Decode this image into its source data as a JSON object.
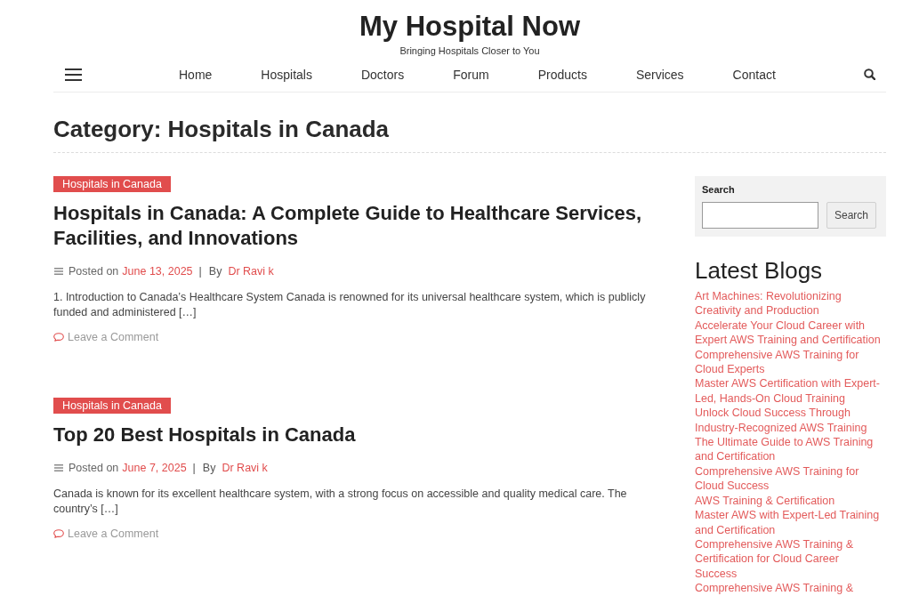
{
  "site": {
    "title": "My Hospital Now",
    "tagline": "Bringing Hospitals Closer to You"
  },
  "nav": [
    "Home",
    "Hospitals",
    "Doctors",
    "Forum",
    "Products",
    "Services",
    "Contact"
  ],
  "page_title": "Category: Hospitals in Canada",
  "posts": [
    {
      "category": "Hospitals in Canada",
      "title": "Hospitals in Canada: A Complete Guide to Healthcare Services, Facilities, and Innovations",
      "posted_label": "Posted on",
      "date": "June 13, 2025",
      "separator": "|",
      "by_label": "By",
      "author": "Dr Ravi k",
      "excerpt": "1. Introduction to Canada’s Healthcare System Canada is renowned for its universal healthcare system, which is publicly funded and administered […]",
      "comment_link": "Leave a Comment"
    },
    {
      "category": "Hospitals in Canada",
      "title": "Top 20 Best Hospitals in Canada",
      "posted_label": "Posted on",
      "date": "June 7, 2025",
      "separator": "|",
      "by_label": "By",
      "author": "Dr Ravi k",
      "excerpt": "Canada is known for its excellent healthcare system, with a strong focus on accessible and quality medical care. The country’s […]",
      "comment_link": "Leave a Comment"
    }
  ],
  "sidebar": {
    "search": {
      "label": "Search",
      "button": "Search"
    },
    "latest_blogs": {
      "title": "Latest Blogs",
      "items": [
        "Art Machines: Revolutionizing Creativity and Production",
        "Accelerate Your Cloud Career with Expert AWS Training and Certification",
        "Comprehensive AWS Training for Cloud Experts",
        "Master AWS Certification with Expert-Led, Hands-On Cloud Training",
        "Unlock Cloud Success Through Industry-Recognized AWS Training",
        "The Ultimate Guide to AWS Training and Certification",
        "Comprehensive AWS Training for Cloud Success",
        "AWS Training & Certification",
        "Master AWS with Expert-Led Training and Certification",
        "Comprehensive AWS Training & Certification for Cloud Career Success",
        "Comprehensive AWS Training &"
      ]
    }
  }
}
